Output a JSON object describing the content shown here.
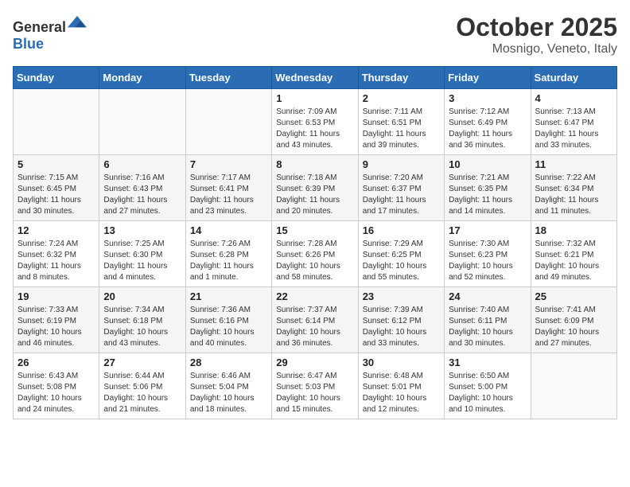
{
  "header": {
    "logo_general": "General",
    "logo_blue": "Blue",
    "month": "October 2025",
    "location": "Mosnigo, Veneto, Italy"
  },
  "weekdays": [
    "Sunday",
    "Monday",
    "Tuesday",
    "Wednesday",
    "Thursday",
    "Friday",
    "Saturday"
  ],
  "weeks": [
    [
      {
        "day": "",
        "info": ""
      },
      {
        "day": "",
        "info": ""
      },
      {
        "day": "",
        "info": ""
      },
      {
        "day": "1",
        "info": "Sunrise: 7:09 AM\nSunset: 6:53 PM\nDaylight: 11 hours\nand 43 minutes."
      },
      {
        "day": "2",
        "info": "Sunrise: 7:11 AM\nSunset: 6:51 PM\nDaylight: 11 hours\nand 39 minutes."
      },
      {
        "day": "3",
        "info": "Sunrise: 7:12 AM\nSunset: 6:49 PM\nDaylight: 11 hours\nand 36 minutes."
      },
      {
        "day": "4",
        "info": "Sunrise: 7:13 AM\nSunset: 6:47 PM\nDaylight: 11 hours\nand 33 minutes."
      }
    ],
    [
      {
        "day": "5",
        "info": "Sunrise: 7:15 AM\nSunset: 6:45 PM\nDaylight: 11 hours\nand 30 minutes."
      },
      {
        "day": "6",
        "info": "Sunrise: 7:16 AM\nSunset: 6:43 PM\nDaylight: 11 hours\nand 27 minutes."
      },
      {
        "day": "7",
        "info": "Sunrise: 7:17 AM\nSunset: 6:41 PM\nDaylight: 11 hours\nand 23 minutes."
      },
      {
        "day": "8",
        "info": "Sunrise: 7:18 AM\nSunset: 6:39 PM\nDaylight: 11 hours\nand 20 minutes."
      },
      {
        "day": "9",
        "info": "Sunrise: 7:20 AM\nSunset: 6:37 PM\nDaylight: 11 hours\nand 17 minutes."
      },
      {
        "day": "10",
        "info": "Sunrise: 7:21 AM\nSunset: 6:35 PM\nDaylight: 11 hours\nand 14 minutes."
      },
      {
        "day": "11",
        "info": "Sunrise: 7:22 AM\nSunset: 6:34 PM\nDaylight: 11 hours\nand 11 minutes."
      }
    ],
    [
      {
        "day": "12",
        "info": "Sunrise: 7:24 AM\nSunset: 6:32 PM\nDaylight: 11 hours\nand 8 minutes."
      },
      {
        "day": "13",
        "info": "Sunrise: 7:25 AM\nSunset: 6:30 PM\nDaylight: 11 hours\nand 4 minutes."
      },
      {
        "day": "14",
        "info": "Sunrise: 7:26 AM\nSunset: 6:28 PM\nDaylight: 11 hours\nand 1 minute."
      },
      {
        "day": "15",
        "info": "Sunrise: 7:28 AM\nSunset: 6:26 PM\nDaylight: 10 hours\nand 58 minutes."
      },
      {
        "day": "16",
        "info": "Sunrise: 7:29 AM\nSunset: 6:25 PM\nDaylight: 10 hours\nand 55 minutes."
      },
      {
        "day": "17",
        "info": "Sunrise: 7:30 AM\nSunset: 6:23 PM\nDaylight: 10 hours\nand 52 minutes."
      },
      {
        "day": "18",
        "info": "Sunrise: 7:32 AM\nSunset: 6:21 PM\nDaylight: 10 hours\nand 49 minutes."
      }
    ],
    [
      {
        "day": "19",
        "info": "Sunrise: 7:33 AM\nSunset: 6:19 PM\nDaylight: 10 hours\nand 46 minutes."
      },
      {
        "day": "20",
        "info": "Sunrise: 7:34 AM\nSunset: 6:18 PM\nDaylight: 10 hours\nand 43 minutes."
      },
      {
        "day": "21",
        "info": "Sunrise: 7:36 AM\nSunset: 6:16 PM\nDaylight: 10 hours\nand 40 minutes."
      },
      {
        "day": "22",
        "info": "Sunrise: 7:37 AM\nSunset: 6:14 PM\nDaylight: 10 hours\nand 36 minutes."
      },
      {
        "day": "23",
        "info": "Sunrise: 7:39 AM\nSunset: 6:12 PM\nDaylight: 10 hours\nand 33 minutes."
      },
      {
        "day": "24",
        "info": "Sunrise: 7:40 AM\nSunset: 6:11 PM\nDaylight: 10 hours\nand 30 minutes."
      },
      {
        "day": "25",
        "info": "Sunrise: 7:41 AM\nSunset: 6:09 PM\nDaylight: 10 hours\nand 27 minutes."
      }
    ],
    [
      {
        "day": "26",
        "info": "Sunrise: 6:43 AM\nSunset: 5:08 PM\nDaylight: 10 hours\nand 24 minutes."
      },
      {
        "day": "27",
        "info": "Sunrise: 6:44 AM\nSunset: 5:06 PM\nDaylight: 10 hours\nand 21 minutes."
      },
      {
        "day": "28",
        "info": "Sunrise: 6:46 AM\nSunset: 5:04 PM\nDaylight: 10 hours\nand 18 minutes."
      },
      {
        "day": "29",
        "info": "Sunrise: 6:47 AM\nSunset: 5:03 PM\nDaylight: 10 hours\nand 15 minutes."
      },
      {
        "day": "30",
        "info": "Sunrise: 6:48 AM\nSunset: 5:01 PM\nDaylight: 10 hours\nand 12 minutes."
      },
      {
        "day": "31",
        "info": "Sunrise: 6:50 AM\nSunset: 5:00 PM\nDaylight: 10 hours\nand 10 minutes."
      },
      {
        "day": "",
        "info": ""
      }
    ]
  ]
}
